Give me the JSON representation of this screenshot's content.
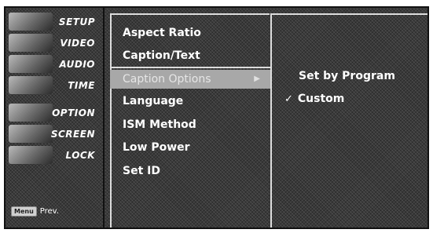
{
  "sidebar": {
    "items": [
      {
        "label": "SETUP"
      },
      {
        "label": "VIDEO"
      },
      {
        "label": "AUDIO"
      },
      {
        "label": "TIME"
      },
      {
        "label": "OPTION"
      },
      {
        "label": "SCREEN"
      },
      {
        "label": "LOCK"
      }
    ],
    "menu_button_label": "Menu",
    "prev_label": "Prev."
  },
  "menu": {
    "items": [
      {
        "label": "Aspect Ratio"
      },
      {
        "label": "Caption/Text"
      },
      {
        "label": "Caption Options",
        "selected": true
      },
      {
        "label": "Language"
      },
      {
        "label": "ISM Method"
      },
      {
        "label": "Low Power"
      },
      {
        "label": "Set ID"
      }
    ],
    "selected_arrow": "▶"
  },
  "submenu": {
    "options": [
      {
        "label": "Set by Program",
        "checked": false
      },
      {
        "label": "Custom",
        "checked": true
      }
    ],
    "check_glyph": "✓"
  },
  "colors": {
    "background": "#3a3a3a",
    "highlight": "#a8a8a8",
    "text": "#ffffff"
  }
}
